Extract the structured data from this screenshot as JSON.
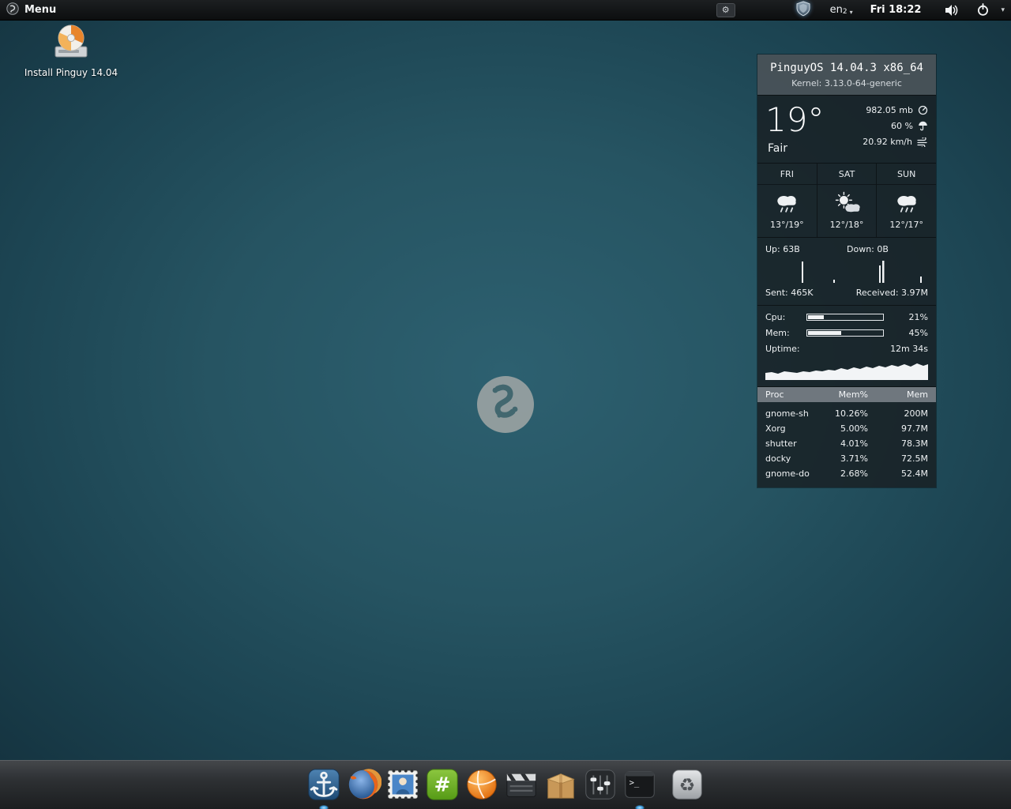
{
  "panel": {
    "menu_label": "Menu",
    "keyboard": {
      "layout": "en",
      "variant": "2",
      "caret": "▾"
    },
    "clock": "Fri 18:22",
    "caret": "▾"
  },
  "glyphs": {
    "gear": "⚙",
    "recycle": "♻",
    "hash": "#",
    "prompt": ">_"
  },
  "desktop": {
    "installer_label": "Install Pinguy 14.04"
  },
  "conky": {
    "title": "PinguyOS 14.04.3 x86_64",
    "kernel": "Kernel: 3.13.0-64-generic",
    "weather": {
      "temp": "19°",
      "condition": "Fair",
      "pressure": "982.05 mb",
      "humidity": "60 %",
      "wind": "20.92 km/h"
    },
    "forecast": [
      {
        "day": "FRI",
        "temps": "13°/19°",
        "icon": "rain-icon"
      },
      {
        "day": "SAT",
        "temps": "12°/18°",
        "icon": "partly-sunny-icon"
      },
      {
        "day": "SUN",
        "temps": "12°/17°",
        "icon": "rain-icon"
      }
    ],
    "network": {
      "up": "Up: 63B",
      "down": "Down: 0B",
      "sent": "Sent: 465K",
      "received": "Received: 3.97M"
    },
    "system": {
      "cpu_label": "Cpu:",
      "cpu_value": "21%",
      "cpu_pct": 21,
      "mem_label": "Mem:",
      "mem_value": "45%",
      "mem_pct": 45,
      "uptime_label": "Uptime:",
      "uptime_value": "12m 34s"
    },
    "processes": {
      "headers": [
        "Proc",
        "Mem%",
        "Mem"
      ],
      "rows": [
        [
          "gnome-sh",
          "10.26%",
          "200M"
        ],
        [
          "Xorg",
          "5.00%",
          "97.7M"
        ],
        [
          "shutter",
          "4.01%",
          "78.3M"
        ],
        [
          "docky",
          "3.71%",
          "72.5M"
        ],
        [
          "gnome-do",
          "2.68%",
          "52.4M"
        ]
      ]
    }
  },
  "dock": {
    "items": [
      {
        "icon": "anchor-icon",
        "running": true
      },
      {
        "icon": "firefox-icon",
        "running": false
      },
      {
        "icon": "stamp-icon",
        "running": false
      },
      {
        "icon": "hash-icon",
        "running": false
      },
      {
        "icon": "orange-ball-icon",
        "running": false
      },
      {
        "icon": "clapperboard-icon",
        "running": false
      },
      {
        "icon": "package-icon",
        "running": false
      },
      {
        "icon": "equalizer-icon",
        "running": false
      },
      {
        "icon": "terminal-icon",
        "running": true
      },
      {
        "icon": "trash-icon",
        "running": false
      }
    ]
  }
}
